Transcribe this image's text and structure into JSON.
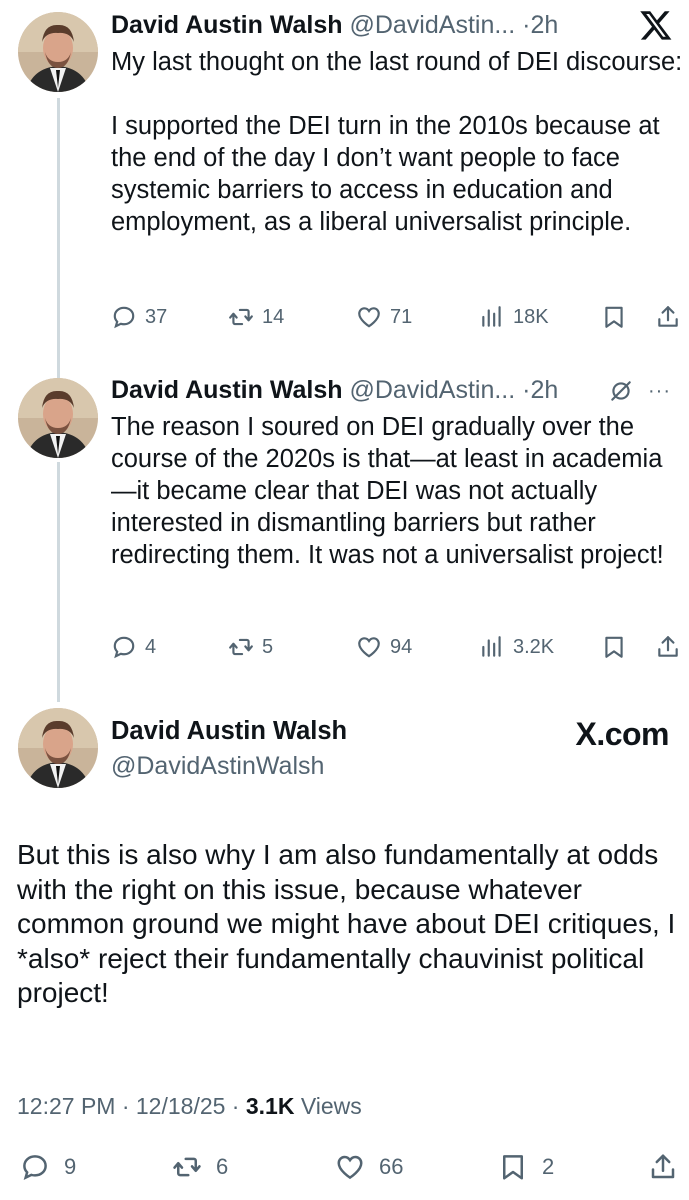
{
  "header": {
    "x_logo_icon": "x-logo-icon"
  },
  "tweets": [
    {
      "name": "David Austin Walsh",
      "handle": "@DavidAstin...",
      "dot": "·",
      "time": "2h",
      "paragraphs": [
        "My last thought on the last round of DEI discourse:",
        "I supported the DEI turn in the 2010s because at the end of the day I don’t want people to face systemic barriers to access in education and employment, as a liberal universalist principle."
      ],
      "replies": "37",
      "reposts": "14",
      "likes": "71",
      "views": "18K"
    },
    {
      "name": "David Austin Walsh",
      "handle": "@DavidAstin...",
      "dot": "·",
      "time": "2h",
      "paragraphs": [
        "The reason I soured on DEI gradually over the course of the 2020s is that—at least in academia—it became clear that DEI was not actually interested in dismantling barriers but rather redirecting them. It was not a universalist project!"
      ],
      "replies": "4",
      "reposts": "5",
      "likes": "94",
      "views": "3.2K",
      "more": "···"
    }
  ],
  "main_tweet": {
    "name": "David Austin Walsh",
    "handle": "@DavidAstinWalsh",
    "watermark": "X.com",
    "text": "But this is also why I am also fundamentally at odds with the right on this issue, because whatever common ground we might have about DEI critiques, I *also* reject their fundamentally chauvinist political project!",
    "timestamp": "12:27 PM · 12/18/25 · ",
    "views_count": "3.1K",
    "views_label": " Views",
    "replies": "9",
    "reposts": "6",
    "likes": "66",
    "bookmarks": "2"
  }
}
